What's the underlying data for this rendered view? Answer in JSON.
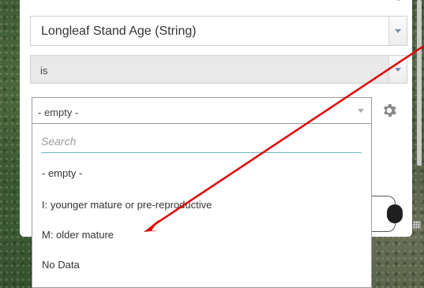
{
  "filter": {
    "field_value": "Longleaf Stand Age (String)",
    "operator_value": "is",
    "value_current": "- empty -",
    "search_placeholder": "Search",
    "options": [
      "- empty -",
      "I:  younger mature or pre-reproductive",
      "M:  older mature",
      "No Data"
    ]
  },
  "annotation": {
    "color": "#e00000"
  },
  "icons": {
    "settings": "gear-icon",
    "collapse": "chevron-up-icon"
  }
}
